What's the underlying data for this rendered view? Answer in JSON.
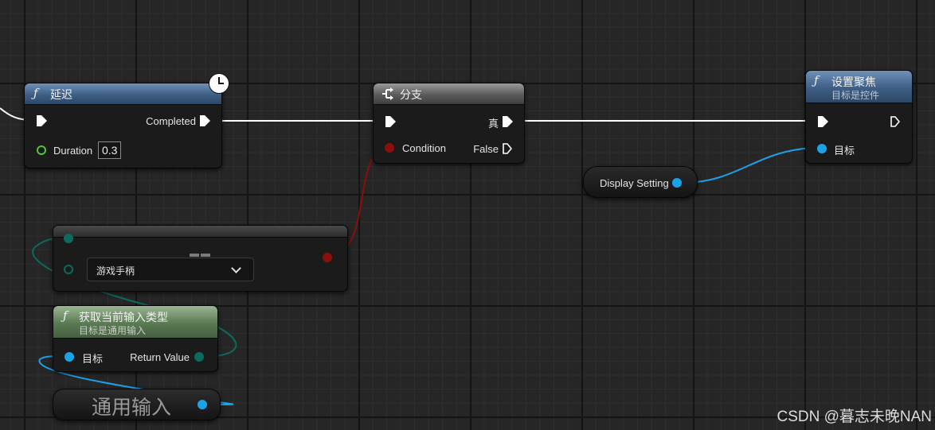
{
  "nodes": {
    "delay": {
      "title": "延迟",
      "completed_label": "Completed",
      "duration_label": "Duration",
      "duration_value": "0.3",
      "icon": "function-icon",
      "badge_icon": "clock-icon"
    },
    "branch": {
      "title": "分支",
      "true_label": "真",
      "condition_label": "Condition",
      "false_label": "False",
      "icon": "branch-icon"
    },
    "set_focus": {
      "title": "设置聚焦",
      "subtitle": "目标是控件",
      "target_label": "目标",
      "icon": "function-icon"
    },
    "display_setting": {
      "label": "Display Setting"
    },
    "equal": {
      "select_value": "游戏手柄",
      "icon": "chevron-down-icon"
    },
    "get_input": {
      "title": "获取当前输入类型",
      "subtitle": "目标是通用输入",
      "target_label": "目标",
      "return_label": "Return Value",
      "icon": "function-icon"
    },
    "common_input": {
      "label": "通用输入"
    }
  },
  "colors": {
    "exec_wire": "#ffffff",
    "object_wire": "#1aa3e8",
    "bool_wire": "#8a0f0f",
    "enum_wire": "#0d6a5e",
    "float_pin": "#56c43a"
  },
  "watermark": "CSDN @暮志未晚NAN"
}
